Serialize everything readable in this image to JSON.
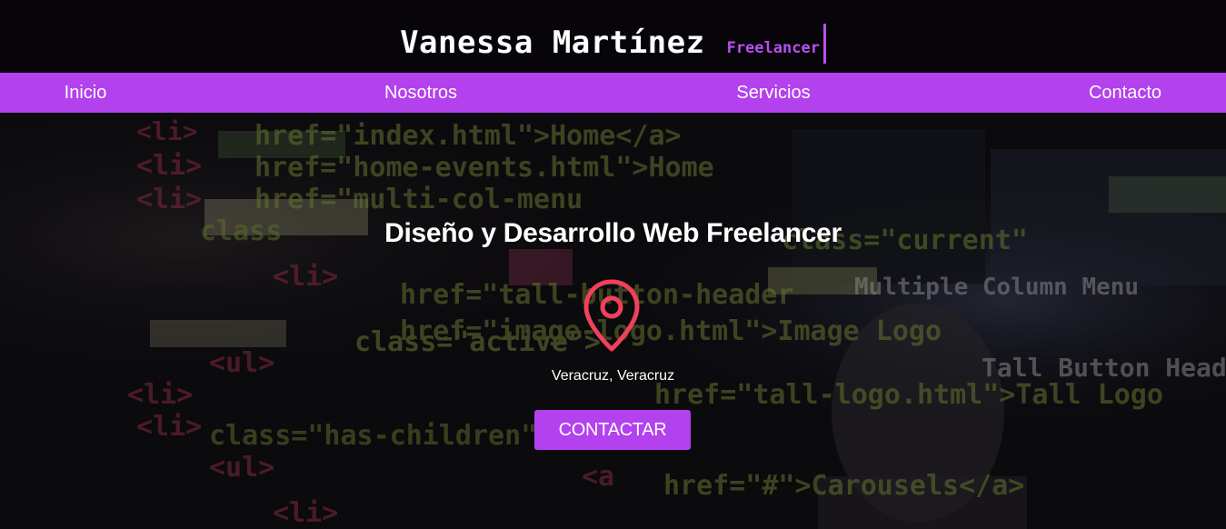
{
  "header": {
    "name": "Vanessa Martínez",
    "tagline": "Freelancer"
  },
  "nav": {
    "items": [
      {
        "label": "Inicio"
      },
      {
        "label": "Nosotros"
      },
      {
        "label": "Servicios"
      },
      {
        "label": "Contacto"
      }
    ]
  },
  "hero": {
    "title": "Diseño y Desarrollo Web Freelancer",
    "pin_icon": "location-pin-icon",
    "location": "Veracruz, Veracruz",
    "cta_label": "CONTACTAR",
    "background": "code-screen-photo"
  },
  "colors": {
    "accent": "#b341ee",
    "pin": "#f0405c",
    "header_bg": "#07040a"
  }
}
